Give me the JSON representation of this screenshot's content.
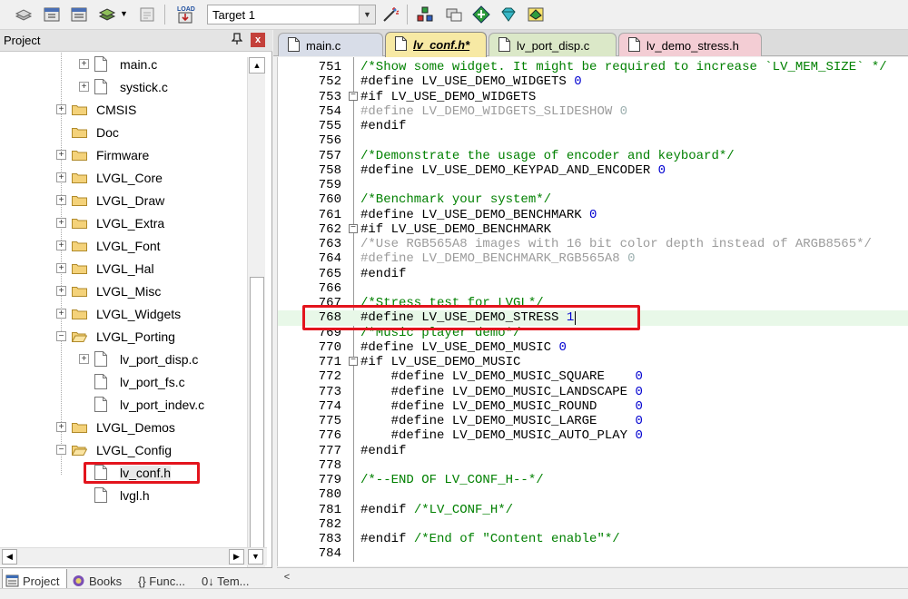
{
  "toolbar": {
    "target": "Target 1",
    "load_label": "LOAD"
  },
  "project_panel": {
    "title": "Project",
    "close_label": "x",
    "pin_label": "ф",
    "tree": [
      {
        "label": "main.c",
        "kind": "file",
        "expander": "+",
        "depth": 3
      },
      {
        "label": "systick.c",
        "kind": "file",
        "expander": "+",
        "depth": 3
      },
      {
        "label": "CMSIS",
        "kind": "folder",
        "expander": "+",
        "depth": 2
      },
      {
        "label": "Doc",
        "kind": "folder",
        "expander": "",
        "depth": 2
      },
      {
        "label": "Firmware",
        "kind": "folder",
        "expander": "+",
        "depth": 2
      },
      {
        "label": "LVGL_Core",
        "kind": "folder",
        "expander": "+",
        "depth": 2
      },
      {
        "label": "LVGL_Draw",
        "kind": "folder",
        "expander": "+",
        "depth": 2
      },
      {
        "label": "LVGL_Extra",
        "kind": "folder",
        "expander": "+",
        "depth": 2
      },
      {
        "label": "LVGL_Font",
        "kind": "folder",
        "expander": "+",
        "depth": 2
      },
      {
        "label": "LVGL_Hal",
        "kind": "folder",
        "expander": "+",
        "depth": 2
      },
      {
        "label": "LVGL_Misc",
        "kind": "folder",
        "expander": "+",
        "depth": 2
      },
      {
        "label": "LVGL_Widgets",
        "kind": "folder",
        "expander": "+",
        "depth": 2
      },
      {
        "label": "LVGL_Porting",
        "kind": "folder-open",
        "expander": "−",
        "depth": 2
      },
      {
        "label": "lv_port_disp.c",
        "kind": "file",
        "expander": "+",
        "depth": 3
      },
      {
        "label": "lv_port_fs.c",
        "kind": "file",
        "expander": "",
        "depth": 3
      },
      {
        "label": "lv_port_indev.c",
        "kind": "file",
        "expander": "",
        "depth": 3
      },
      {
        "label": "LVGL_Demos",
        "kind": "folder",
        "expander": "+",
        "depth": 2
      },
      {
        "label": "LVGL_Config",
        "kind": "folder-open",
        "expander": "−",
        "depth": 2
      },
      {
        "label": "lv_conf.h",
        "kind": "file",
        "expander": "",
        "depth": 3,
        "selected": true
      },
      {
        "label": "lvgl.h",
        "kind": "file",
        "expander": "",
        "depth": 3
      }
    ],
    "bottom_tabs": [
      {
        "label": "Project",
        "active": true
      },
      {
        "label": "Books",
        "active": false
      },
      {
        "label": "{} Func...",
        "active": false
      },
      {
        "label": "0↓ Tem...",
        "active": false
      }
    ]
  },
  "editor_tabs": [
    {
      "label": "main.c",
      "active": false,
      "color": "#d8dde8"
    },
    {
      "label": "lv_conf.h*",
      "active": true,
      "color": "#f7e9a4"
    },
    {
      "label": "lv_port_disp.c",
      "active": false,
      "color": "#dbe8c8"
    },
    {
      "label": "lv_demo_stress.h",
      "active": false,
      "color": "#f3cdd4"
    }
  ],
  "editor": {
    "first_line_number": 751,
    "current_line": 768,
    "lines": [
      {
        "n": "751",
        "fold": "",
        "parts": [
          [
            "comment",
            "/*Show some widget. It might be required to increase `LV_MEM_SIZE` */"
          ]
        ]
      },
      {
        "n": "752",
        "fold": "",
        "parts": [
          [
            "normal",
            "#define LV_USE_DEMO_WIDGETS "
          ],
          [
            "number",
            "0"
          ]
        ]
      },
      {
        "n": "753",
        "fold": "−",
        "parts": [
          [
            "normal",
            "#if LV_USE_DEMO_WIDGETS"
          ]
        ]
      },
      {
        "n": "754",
        "fold": "",
        "parts": [
          [
            "disabled",
            "#define LV_DEMO_WIDGETS_SLIDESHOW "
          ],
          [
            "disnum",
            "0"
          ]
        ]
      },
      {
        "n": "755",
        "fold": "",
        "parts": [
          [
            "normal",
            "#endif"
          ]
        ]
      },
      {
        "n": "756",
        "fold": "",
        "parts": []
      },
      {
        "n": "757",
        "fold": "",
        "parts": [
          [
            "comment",
            "/*Demonstrate the usage of encoder and keyboard*/"
          ]
        ]
      },
      {
        "n": "758",
        "fold": "",
        "parts": [
          [
            "normal",
            "#define LV_USE_DEMO_KEYPAD_AND_ENCODER "
          ],
          [
            "number",
            "0"
          ]
        ]
      },
      {
        "n": "759",
        "fold": "",
        "parts": []
      },
      {
        "n": "760",
        "fold": "",
        "parts": [
          [
            "comment",
            "/*Benchmark your system*/"
          ]
        ]
      },
      {
        "n": "761",
        "fold": "",
        "parts": [
          [
            "normal",
            "#define LV_USE_DEMO_BENCHMARK "
          ],
          [
            "number",
            "0"
          ]
        ]
      },
      {
        "n": "762",
        "fold": "−",
        "parts": [
          [
            "normal",
            "#if LV_USE_DEMO_BENCHMARK"
          ]
        ]
      },
      {
        "n": "763",
        "fold": "",
        "parts": [
          [
            "disabled",
            "/*Use RGB565A8 images with 16 bit color depth instead of ARGB8565*/"
          ]
        ]
      },
      {
        "n": "764",
        "fold": "",
        "parts": [
          [
            "disabled",
            "#define LV_DEMO_BENCHMARK_RGB565A8 "
          ],
          [
            "disnum",
            "0"
          ]
        ]
      },
      {
        "n": "765",
        "fold": "",
        "parts": [
          [
            "normal",
            "#endif"
          ]
        ]
      },
      {
        "n": "766",
        "fold": "",
        "parts": []
      },
      {
        "n": "767",
        "fold": "",
        "parts": [
          [
            "comment",
            "/*Stress test for LVGL*/"
          ]
        ]
      },
      {
        "n": "768",
        "fold": "",
        "parts": [
          [
            "normal",
            "#define LV_USE_DEMO_STRESS "
          ],
          [
            "number",
            "1"
          ]
        ]
      },
      {
        "n": "769",
        "fold": "",
        "parts": [
          [
            "comment",
            "/*Music player demo*/"
          ]
        ]
      },
      {
        "n": "770",
        "fold": "",
        "parts": [
          [
            "normal",
            "#define LV_USE_DEMO_MUSIC "
          ],
          [
            "number",
            "0"
          ]
        ]
      },
      {
        "n": "771",
        "fold": "−",
        "parts": [
          [
            "normal",
            "#if LV_USE_DEMO_MUSIC"
          ]
        ]
      },
      {
        "n": "772",
        "fold": "",
        "parts": [
          [
            "normal",
            "    #define LV_DEMO_MUSIC_SQUARE    "
          ],
          [
            "number",
            "0"
          ]
        ]
      },
      {
        "n": "773",
        "fold": "",
        "parts": [
          [
            "normal",
            "    #define LV_DEMO_MUSIC_LANDSCAPE "
          ],
          [
            "number",
            "0"
          ]
        ]
      },
      {
        "n": "774",
        "fold": "",
        "parts": [
          [
            "normal",
            "    #define LV_DEMO_MUSIC_ROUND     "
          ],
          [
            "number",
            "0"
          ]
        ]
      },
      {
        "n": "775",
        "fold": "",
        "parts": [
          [
            "normal",
            "    #define LV_DEMO_MUSIC_LARGE     "
          ],
          [
            "number",
            "0"
          ]
        ]
      },
      {
        "n": "776",
        "fold": "",
        "parts": [
          [
            "normal",
            "    #define LV_DEMO_MUSIC_AUTO_PLAY "
          ],
          [
            "number",
            "0"
          ]
        ]
      },
      {
        "n": "777",
        "fold": "",
        "parts": [
          [
            "normal",
            "#endif"
          ]
        ]
      },
      {
        "n": "778",
        "fold": "",
        "parts": []
      },
      {
        "n": "779",
        "fold": "",
        "parts": [
          [
            "comment",
            "/*--END OF LV_CONF_H--*/"
          ]
        ]
      },
      {
        "n": "780",
        "fold": "",
        "parts": []
      },
      {
        "n": "781",
        "fold": "",
        "parts": [
          [
            "normal",
            "#endif "
          ],
          [
            "comment",
            "/*LV_CONF_H*/"
          ]
        ]
      },
      {
        "n": "782",
        "fold": "",
        "parts": []
      },
      {
        "n": "783",
        "fold": "",
        "parts": [
          [
            "normal",
            "#endif "
          ],
          [
            "comment",
            "/*End of \"Content enable\"*/"
          ]
        ]
      },
      {
        "n": "784",
        "fold": "",
        "parts": []
      }
    ]
  },
  "colors": {
    "comment": "#008000",
    "number": "#0000d0",
    "disabled": "#9c9c9c",
    "highlight": "#e3141d",
    "current_line": "#e8f8e8"
  }
}
